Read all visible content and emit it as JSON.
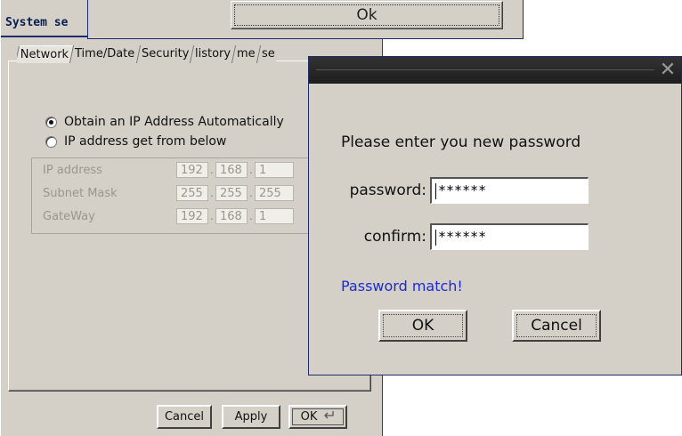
{
  "top_window": {
    "ok_label": "Ok"
  },
  "system_window": {
    "title": "System se",
    "tabs": [
      "Network",
      "Time/Date",
      "Security",
      "listory",
      "me",
      "se"
    ],
    "radio_auto": "Obtain an IP Address Automatically",
    "radio_manual": "IP address get from below",
    "radio_selected": "auto",
    "ip_rows": [
      {
        "label": "IP address",
        "octets": [
          "192",
          "168",
          "1"
        ]
      },
      {
        "label": "Subnet Mask",
        "octets": [
          "255",
          "255",
          "255"
        ]
      },
      {
        "label": "GateWay",
        "octets": [
          "192",
          "168",
          "1"
        ]
      }
    ],
    "buttons": {
      "cancel": "Cancel",
      "apply": "Apply",
      "ok": "OK"
    }
  },
  "password_dialog": {
    "close_glyph": "✕",
    "prompt": "Please enter you new password",
    "password_label": "password:",
    "password_value": "******",
    "confirm_label": "confirm:",
    "confirm_value": "******",
    "status": "Password match!",
    "ok_label": "OK",
    "cancel_label": "Cancel",
    "colors": {
      "status": "#1a2ad8",
      "titlebar": "#2a2a2a"
    }
  }
}
